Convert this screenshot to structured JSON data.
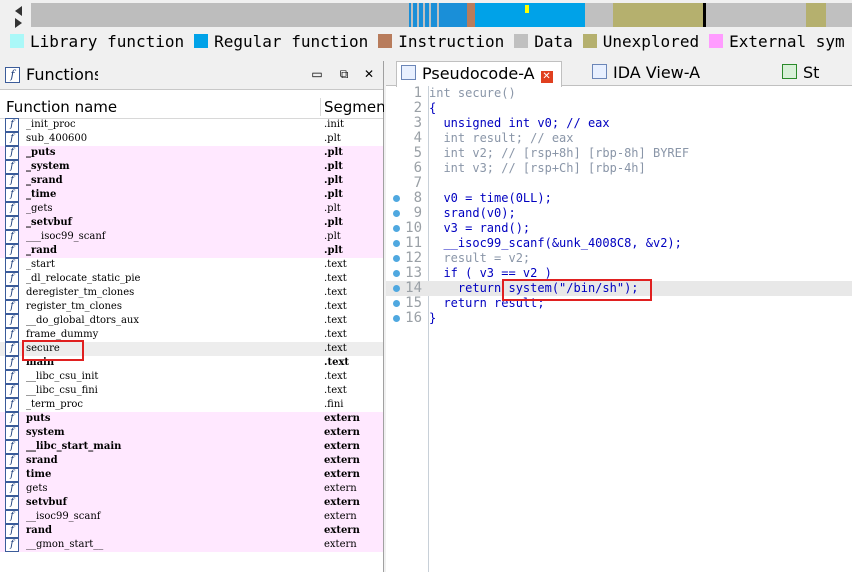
{
  "legend": [
    {
      "label": "Library function",
      "color": "#aaf8f8"
    },
    {
      "label": "Regular function",
      "color": "#00a2e8"
    },
    {
      "label": "Instruction",
      "color": "#b87c5c"
    },
    {
      "label": "Data",
      "color": "#c0c0c0"
    },
    {
      "label": "Unexplored",
      "color": "#b5b06e"
    },
    {
      "label": "External sym",
      "color": "#ff9cff"
    }
  ],
  "functions_panel": {
    "title": "Functions",
    "col_name": "Function name",
    "col_segment": "Segment",
    "rows": [
      {
        "name": "_init_proc",
        "segment": ".init",
        "bold": false,
        "pink": false
      },
      {
        "name": "sub_400600",
        "segment": ".plt",
        "bold": false,
        "pink": false
      },
      {
        "name": "_puts",
        "segment": ".plt",
        "bold": true,
        "pink": true
      },
      {
        "name": "_system",
        "segment": ".plt",
        "bold": true,
        "pink": true
      },
      {
        "name": "_srand",
        "segment": ".plt",
        "bold": true,
        "pink": true
      },
      {
        "name": "_time",
        "segment": ".plt",
        "bold": true,
        "pink": true
      },
      {
        "name": "_gets",
        "segment": ".plt",
        "bold": false,
        "pink": true
      },
      {
        "name": "_setvbuf",
        "segment": ".plt",
        "bold": true,
        "pink": true
      },
      {
        "name": "___isoc99_scanf",
        "segment": ".plt",
        "bold": false,
        "pink": true
      },
      {
        "name": "_rand",
        "segment": ".plt",
        "bold": true,
        "pink": true
      },
      {
        "name": "_start",
        "segment": ".text",
        "bold": false,
        "pink": false
      },
      {
        "name": "_dl_relocate_static_pie",
        "segment": ".text",
        "bold": false,
        "pink": false
      },
      {
        "name": "deregister_tm_clones",
        "segment": ".text",
        "bold": false,
        "pink": false
      },
      {
        "name": "register_tm_clones",
        "segment": ".text",
        "bold": false,
        "pink": false
      },
      {
        "name": "__do_global_dtors_aux",
        "segment": ".text",
        "bold": false,
        "pink": false
      },
      {
        "name": "frame_dummy",
        "segment": ".text",
        "bold": false,
        "pink": false
      },
      {
        "name": "secure",
        "segment": ".text",
        "bold": false,
        "pink": false,
        "selected": true
      },
      {
        "name": "main",
        "segment": ".text",
        "bold": true,
        "pink": false
      },
      {
        "name": "__libc_csu_init",
        "segment": ".text",
        "bold": false,
        "pink": false
      },
      {
        "name": "__libc_csu_fini",
        "segment": ".text",
        "bold": false,
        "pink": false
      },
      {
        "name": "_term_proc",
        "segment": ".fini",
        "bold": false,
        "pink": false
      },
      {
        "name": "puts",
        "segment": "extern",
        "bold": true,
        "pink": true
      },
      {
        "name": "system",
        "segment": "extern",
        "bold": true,
        "pink": true
      },
      {
        "name": "__libc_start_main",
        "segment": "extern",
        "bold": true,
        "pink": true
      },
      {
        "name": "srand",
        "segment": "extern",
        "bold": true,
        "pink": true
      },
      {
        "name": "time",
        "segment": "extern",
        "bold": true,
        "pink": true
      },
      {
        "name": "gets",
        "segment": "extern",
        "bold": false,
        "pink": true
      },
      {
        "name": "setvbuf",
        "segment": "extern",
        "bold": true,
        "pink": true
      },
      {
        "name": "__isoc99_scanf",
        "segment": "extern",
        "bold": false,
        "pink": true
      },
      {
        "name": "rand",
        "segment": "extern",
        "bold": true,
        "pink": true
      },
      {
        "name": "__gmon_start__",
        "segment": "extern",
        "bold": false,
        "pink": true
      }
    ]
  },
  "tabs": [
    {
      "label": "Pseudocode-A",
      "active": true
    },
    {
      "label": "IDA View-A",
      "active": false
    },
    {
      "label": "St",
      "active": false
    }
  ],
  "code_lines": [
    {
      "n": "1",
      "text": "int secure()",
      "bp": false,
      "gray": true
    },
    {
      "n": "2",
      "text": "{",
      "bp": false
    },
    {
      "n": "3",
      "text": "  unsigned int v0; // eax",
      "bp": false
    },
    {
      "n": "4",
      "text": "  int result; // eax",
      "bp": false,
      "gray": true
    },
    {
      "n": "5",
      "text": "  int v2; // [rsp+8h] [rbp-8h] BYREF",
      "bp": false,
      "gray": true
    },
    {
      "n": "6",
      "text": "  int v3; // [rsp+Ch] [rbp-4h]",
      "bp": false,
      "gray": true
    },
    {
      "n": "7",
      "text": "",
      "bp": false
    },
    {
      "n": "8",
      "text": "  v0 = time(0LL);",
      "bp": true
    },
    {
      "n": "9",
      "text": "  srand(v0);",
      "bp": true
    },
    {
      "n": "10",
      "text": "  v3 = rand();",
      "bp": true
    },
    {
      "n": "11",
      "text": "  __isoc99_scanf(&unk_4008C8, &v2);",
      "bp": true
    },
    {
      "n": "12",
      "text": "  result = v2;",
      "bp": true,
      "gray": true
    },
    {
      "n": "13",
      "text": "  if ( v3 == v2 )",
      "bp": true
    },
    {
      "n": "14",
      "text": "    return system(\"/bin/sh\");",
      "bp": true,
      "highlight": true
    },
    {
      "n": "15",
      "text": "  return result;",
      "bp": true
    },
    {
      "n": "16",
      "text": "}",
      "bp": true
    }
  ]
}
